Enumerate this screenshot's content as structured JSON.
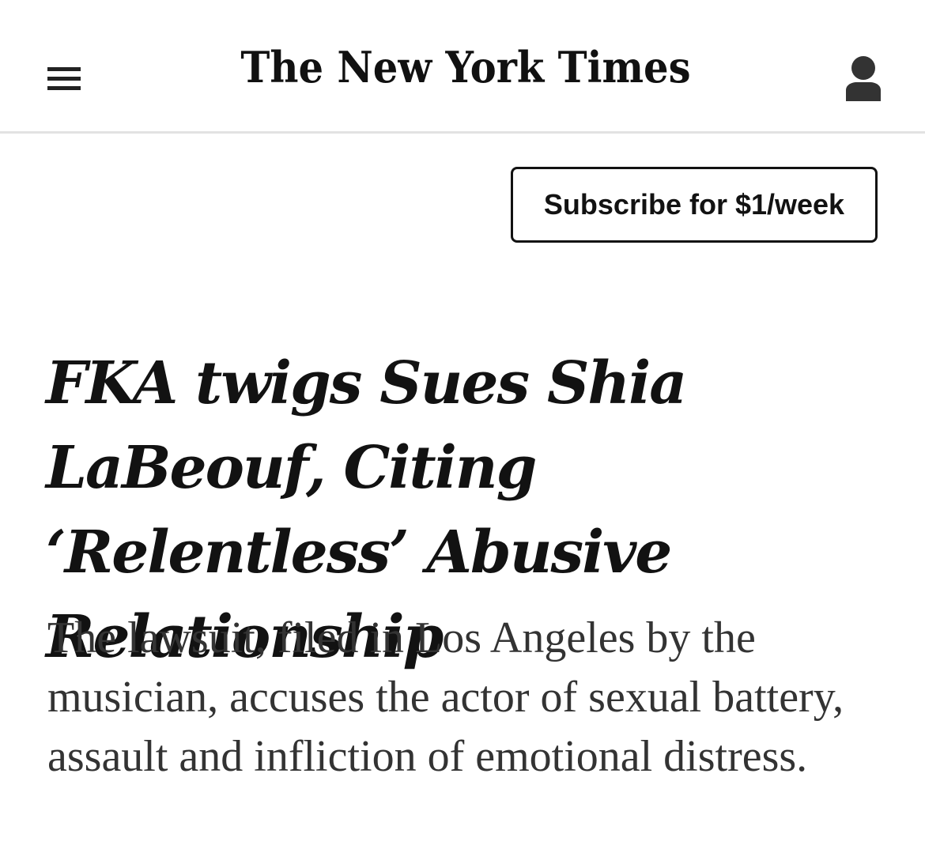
{
  "header": {
    "masthead": "The New York Times",
    "menu_icon": "hamburger-menu-icon",
    "account_icon": "account-person-icon"
  },
  "subscribe": {
    "label": "Subscribe for $1/week"
  },
  "article": {
    "headline": "FKA twigs Sues Shia LaBeouf, Citing ‘Relentless’ Abusive Relationship",
    "summary": "The lawsuit, filed in Los Angeles by the musician, accuses the actor of sexual battery, assault and infliction of emotional distress."
  },
  "colors": {
    "text": "#121212",
    "summary_text": "#333333",
    "divider": "#e2e2e2",
    "background": "#ffffff"
  }
}
